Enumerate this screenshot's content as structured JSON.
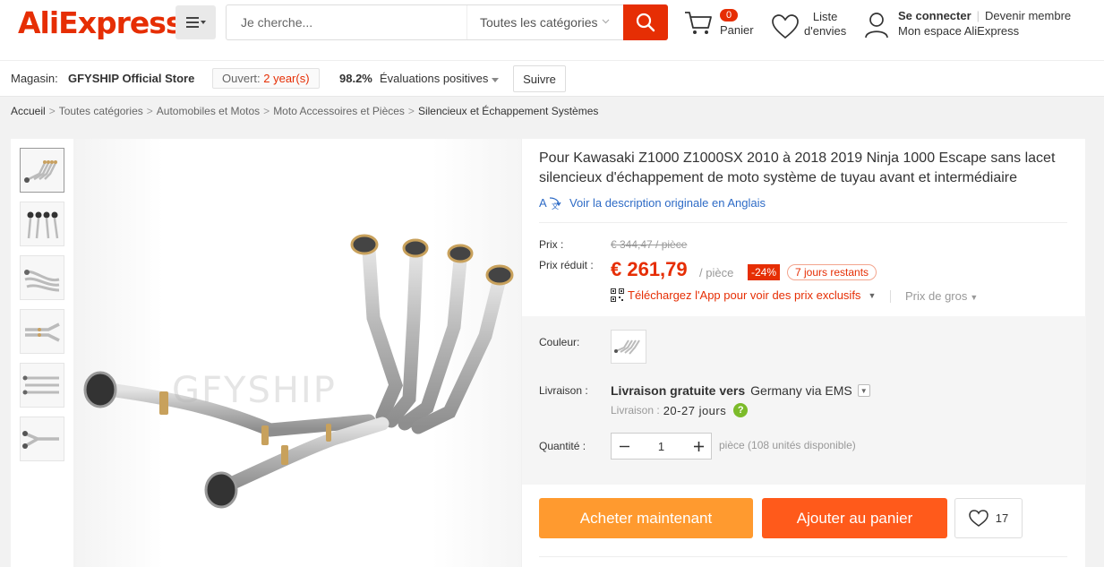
{
  "header": {
    "logo": "AliExpress",
    "logo_tm": "TM",
    "search_placeholder": "Je cherche...",
    "category_select": "Toutes les catégories",
    "cart_count": "0",
    "cart_label": "Panier",
    "wishlist_line1": "Liste",
    "wishlist_line2": "d'envies",
    "signin": "Se connecter",
    "become_member": "Devenir membre",
    "my_account": "Mon espace AliExpress"
  },
  "store": {
    "label": "Magasin:",
    "name": "GFYSHIP Official Store",
    "open_label": "Ouvert:",
    "open_years": "2 year(s)",
    "rating_pct": "98.2%",
    "rating_label": "Évaluations positives",
    "follow": "Suivre"
  },
  "breadcrumb": [
    "Accueil",
    "Toutes catégories",
    "Automobiles et Motos",
    "Moto Accessoires et Pièces",
    "Silencieux et Échappement Systèmes"
  ],
  "product": {
    "title": "Pour Kawasaki Z1000 Z1000SX 2010 à 2018 2019 Ninja 1000 Escape sans lacet silencieux d'échappement de moto système de tuyau avant et intermédiaire",
    "translate_link": "Voir la description originale en Anglais",
    "price_label": "Prix :",
    "orig_price": "€ 344,47 / pièce",
    "sale_label": "Prix réduit :",
    "sale_price": "€ 261,79",
    "per_piece": "/ pièce",
    "discount": "-24%",
    "days_left": "7 jours restants",
    "app_promo": "Téléchargez l'App pour voir des prix exclusifs",
    "wholesale": "Prix de gros",
    "color_label": "Couleur:",
    "shipping_label": "Livraison :",
    "shipping_free": "Livraison gratuite vers",
    "shipping_country": "Germany via EMS",
    "delivery_label": "Livraison :",
    "delivery_days": "20-27 jours",
    "quantity_label": "Quantité :",
    "quantity": "1",
    "availability": "pièce (108 unités disponible)",
    "buy_now": "Acheter maintenant",
    "add_to_cart": "Ajouter au panier",
    "wish_count": "17",
    "watermark": "GFYSHIP"
  },
  "colors": {
    "brand": "#e62e04",
    "buy": "#ff9a2f",
    "cart": "#ff5a1b",
    "link": "#2e6bc6"
  }
}
